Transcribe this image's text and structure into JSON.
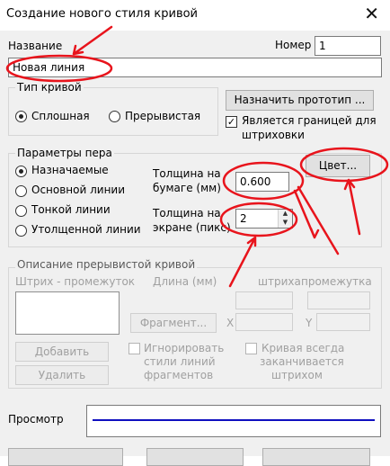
{
  "window": {
    "title": "Создание нового стиля кривой",
    "close": "✕"
  },
  "name": {
    "label": "Название",
    "value": "Новая линия"
  },
  "number": {
    "label": "Номер",
    "value": "1"
  },
  "curve_type": {
    "title": "Тип кривой",
    "options": [
      "Сплошная",
      "Прерывистая"
    ],
    "selected": "Сплошная"
  },
  "assign_prototype_label": "Назначить прототип ...",
  "hatch_boundary": {
    "label_line1": "Является границей для",
    "label_line2": "штриховки",
    "checked": true
  },
  "pen": {
    "title": "Параметры пера",
    "options": [
      "Назначаемые",
      "Основной линии",
      "Тонкой линии",
      "Утолщенной линии"
    ],
    "selected": "Назначаемые",
    "paper_thickness": {
      "label_line1": "Толщина на",
      "label_line2": "бумаге (мм)",
      "value": "0.600"
    },
    "screen_thickness": {
      "label_line1": "Толщина на",
      "label_line2": "экране (пикс)",
      "value": "2"
    },
    "color_button": "Цвет..."
  },
  "dashed": {
    "title": "Описание прерывистой кривой",
    "stroke_gap_label": "Штрих - промежуток",
    "length_label": "Длина (мм)",
    "stroke_label": "штриха",
    "gap_label": "промежутка",
    "fragment_button": "Фрагмент...",
    "x_label": "X",
    "y_label": "Y",
    "add_button": "Добавить",
    "delete_button": "Удалить",
    "ignore_styles": {
      "line1": "Игнорировать",
      "line2": "стили линий",
      "line3": "фрагментов"
    },
    "ends_with_stroke": {
      "line1": "Кривая всегда",
      "line2": "заканчивается",
      "line3": "штрихом"
    }
  },
  "preview": {
    "label": "Просмотр",
    "line_color": "#1010c0"
  },
  "annotation_color": "#e8141c"
}
